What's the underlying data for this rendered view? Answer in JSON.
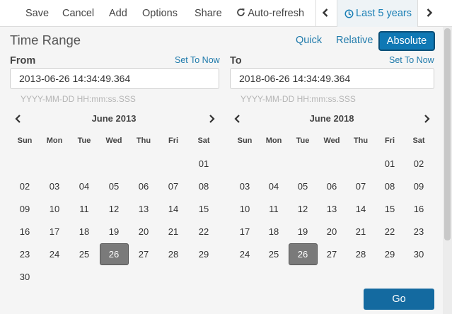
{
  "toolbar": {
    "save": "Save",
    "cancel": "Cancel",
    "add": "Add",
    "options": "Options",
    "share": "Share",
    "auto_refresh": "Auto-refresh",
    "time_label": "Last 5 years"
  },
  "panel": {
    "title": "Time Range",
    "modes": {
      "quick": "Quick",
      "relative": "Relative",
      "absolute": "Absolute"
    },
    "active_mode": "Absolute"
  },
  "from": {
    "label": "From",
    "set_now": "Set To Now",
    "value": "2013-06-26 14:34:49.364",
    "hint": "YYYY-MM-DD HH:mm:ss.SSS",
    "calendar": {
      "title": "June 2013",
      "weekdays": [
        "Sun",
        "Mon",
        "Tue",
        "Wed",
        "Thu",
        "Fri",
        "Sat"
      ],
      "first_weekday": 6,
      "days_in_month": 30,
      "selected": 26
    }
  },
  "to": {
    "label": "To",
    "set_now": "Set To Now",
    "value": "2018-06-26 14:34:49.364",
    "hint": "YYYY-MM-DD HH:mm:ss.SSS",
    "calendar": {
      "title": "June 2018",
      "weekdays": [
        "Sun",
        "Mon",
        "Tue",
        "Wed",
        "Thu",
        "Fri",
        "Sat"
      ],
      "first_weekday": 5,
      "days_in_month": 30,
      "selected": 26
    }
  },
  "go_label": "Go",
  "colors": {
    "accent": "#0f78b4",
    "link": "#1f7aab",
    "selected_day": "#7a7a7a"
  }
}
